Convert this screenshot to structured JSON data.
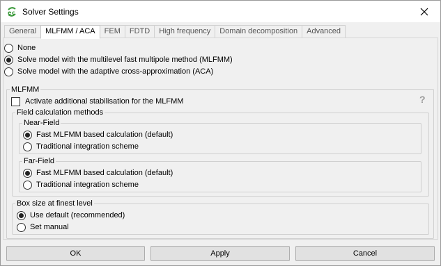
{
  "window": {
    "title": "Solver Settings"
  },
  "icons": {
    "app": "cadfeko-icon",
    "close": "close-icon",
    "help": "help-icon"
  },
  "tabs": [
    {
      "label": "General",
      "active": false
    },
    {
      "label": "MLFMM / ACA",
      "active": true
    },
    {
      "label": "FEM",
      "active": false
    },
    {
      "label": "FDTD",
      "active": false
    },
    {
      "label": "High frequency",
      "active": false
    },
    {
      "label": "Domain decomposition",
      "active": false
    },
    {
      "label": "Advanced",
      "active": false
    }
  ],
  "method": {
    "options": [
      {
        "label": "None",
        "checked": false
      },
      {
        "label": "Solve model with the multilevel fast multipole method (MLFMM)",
        "checked": true
      },
      {
        "label": "Solve model with the adaptive cross-approximation (ACA)",
        "checked": false
      }
    ]
  },
  "mlfmm": {
    "title": "MLFMM",
    "stabilisation": {
      "label": "Activate additional stabilisation for the MLFMM",
      "checked": false
    },
    "help_glyph": "?",
    "field_calc": {
      "title": "Field calculation methods",
      "near": {
        "title": "Near-Field",
        "options": [
          {
            "label": "Fast MLFMM based calculation (default)",
            "checked": true
          },
          {
            "label": "Traditional integration scheme",
            "checked": false
          }
        ]
      },
      "far": {
        "title": "Far-Field",
        "options": [
          {
            "label": "Fast MLFMM based calculation (default)",
            "checked": true
          },
          {
            "label": "Traditional integration scheme",
            "checked": false
          }
        ]
      }
    },
    "box_size": {
      "title": "Box size at finest level",
      "options": [
        {
          "label": "Use default (recommended)",
          "checked": true
        },
        {
          "label": "Set manual",
          "checked": false
        }
      ]
    }
  },
  "buttons": {
    "ok": "OK",
    "apply": "Apply",
    "cancel": "Cancel"
  },
  "colors": {
    "accent": "#3c9a3c",
    "window_bg": "#f0f0f0",
    "titlebar_bg": "#ffffff"
  }
}
